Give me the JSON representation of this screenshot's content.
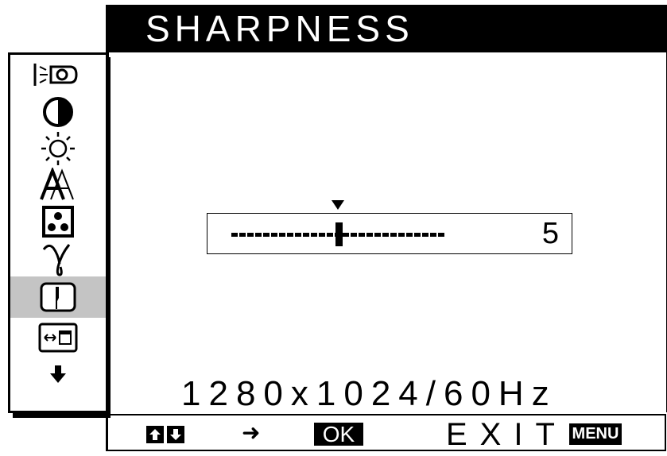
{
  "title": "SHARPNESS",
  "sidebar": {
    "icons": [
      {
        "name": "backlight-icon",
        "selected": false
      },
      {
        "name": "contrast-icon",
        "selected": false
      },
      {
        "name": "brightness-icon",
        "selected": false
      },
      {
        "name": "font-sharpness-icon",
        "selected": false
      },
      {
        "name": "color-icon",
        "selected": false
      },
      {
        "name": "gamma-icon",
        "selected": false
      },
      {
        "name": "sharpness-icon",
        "selected": true
      },
      {
        "name": "position-icon",
        "selected": false
      },
      {
        "name": "more-down-arrow-icon",
        "selected": false
      }
    ]
  },
  "slider": {
    "value": "5",
    "level_fraction": 0.5
  },
  "resolution": "1280x1024/60Hz",
  "bottom_bar": {
    "ok_label": "OK",
    "exit_label": "EXIT",
    "menu_label": "MENU"
  }
}
